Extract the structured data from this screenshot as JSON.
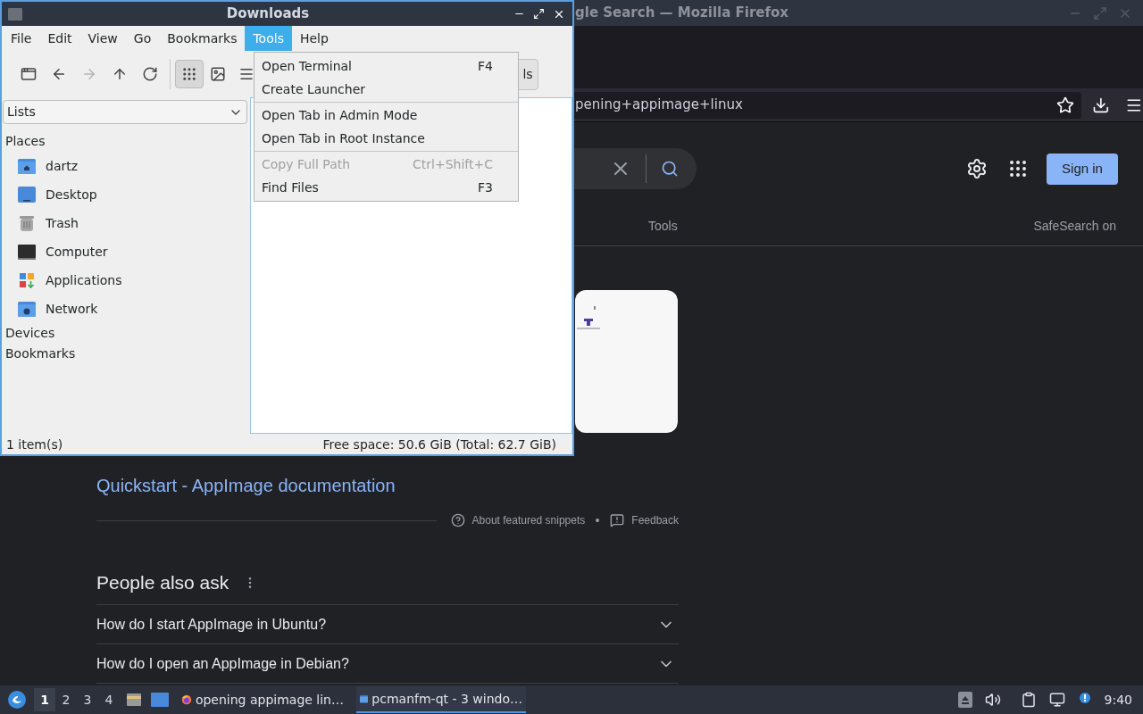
{
  "browser": {
    "title": "gle Search — Mozilla Firefox",
    "url": "pening+appimage+linux",
    "search_tools": "Tools",
    "safesearch": "SafeSearch on",
    "sign_in": "Sign in",
    "result": {
      "title": "Quickstart - AppImage documentation",
      "about": "About featured snippets",
      "feedback": "Feedback"
    },
    "people_also_ask": {
      "heading": "People also ask",
      "questions": [
        {
          "text": "How do I start AppImage in Ubuntu?",
          "expanded": false
        },
        {
          "text": "How do I open an AppImage in Debian?",
          "expanded": false
        }
      ]
    }
  },
  "file_manager": {
    "title": "Downloads",
    "menu": [
      {
        "label": "File",
        "selected": false
      },
      {
        "label": "Edit",
        "selected": false
      },
      {
        "label": "View",
        "selected": false
      },
      {
        "label": "Go",
        "selected": false
      },
      {
        "label": "Bookmarks",
        "selected": false
      },
      {
        "label": "Tools",
        "selected": true
      },
      {
        "label": "Help",
        "selected": false
      }
    ],
    "nav_buttons": [
      {
        "kind": "new-tab",
        "disabled": false
      },
      {
        "kind": "back",
        "disabled": false
      },
      {
        "kind": "forward",
        "disabled": true
      },
      {
        "kind": "up",
        "disabled": false
      },
      {
        "kind": "reload",
        "disabled": false
      }
    ],
    "view_modes": [
      {
        "kind": "icons",
        "selected": true
      },
      {
        "kind": "thumbnails",
        "selected": false
      },
      {
        "kind": "compact",
        "selected": false
      }
    ],
    "path_button": "ls",
    "side_panel": {
      "mode": "Lists",
      "sections": [
        {
          "label": "Places",
          "items": [
            {
              "label": "dartz",
              "kind": "home"
            },
            {
              "label": "Desktop",
              "kind": "desktop"
            },
            {
              "label": "Trash",
              "kind": "trash"
            },
            {
              "label": "Computer",
              "kind": "computer"
            },
            {
              "label": "Applications",
              "kind": "applications"
            },
            {
              "label": "Network",
              "kind": "network"
            }
          ]
        },
        {
          "label": "Devices"
        },
        {
          "label": "Bookmarks"
        }
      ]
    },
    "status": {
      "items": "1 item(s)",
      "free_space": "Free space: 50.6 GiB (Total: 62.7 GiB)"
    },
    "tools_menu": {
      "groups": [
        [
          {
            "label": "Open Terminal",
            "shortcut": "F4",
            "disabled": false
          },
          {
            "label": "Create Launcher",
            "disabled": false
          }
        ],
        [
          {
            "label": "Open Tab in Admin Mode",
            "disabled": false
          },
          {
            "label": "Open Tab in Root Instance",
            "disabled": false
          }
        ],
        [
          {
            "label": "Copy Full Path",
            "shortcut": "Ctrl+Shift+C",
            "disabled": true
          },
          {
            "label": "Find Files",
            "shortcut": "F3",
            "disabled": false
          }
        ]
      ]
    }
  },
  "taskbar": {
    "workspaces": [
      {
        "label": "1",
        "selected": true
      },
      {
        "label": "2",
        "selected": false
      },
      {
        "label": "3",
        "selected": false
      },
      {
        "label": "4",
        "selected": false
      }
    ],
    "tasks": [
      {
        "label": "opening appimage lin…",
        "kind": "browser",
        "selected": false
      },
      {
        "label": "pcmanfm-qt - 3 windo…",
        "kind": "folder",
        "selected": true
      }
    ],
    "clock": "9:40"
  }
}
